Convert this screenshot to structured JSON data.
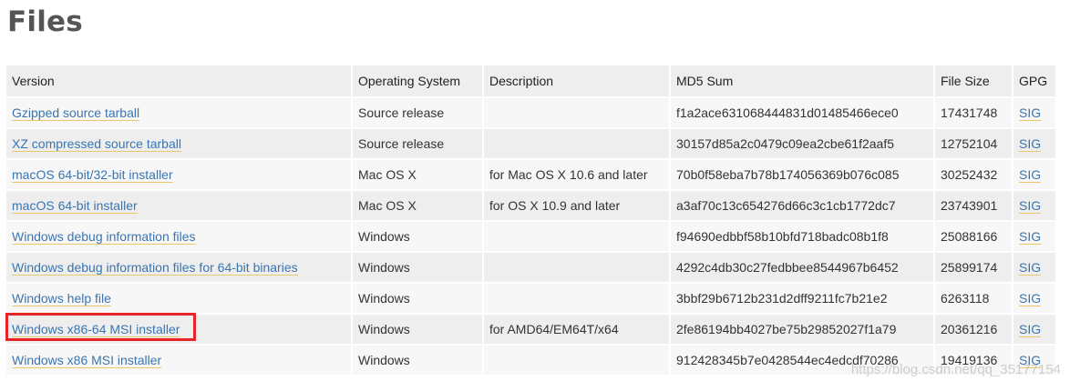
{
  "page": {
    "title": "Files"
  },
  "table": {
    "headers": {
      "version": "Version",
      "os": "Operating System",
      "description": "Description",
      "md5": "MD5 Sum",
      "size": "File Size",
      "gpg": "GPG"
    },
    "rows": [
      {
        "version": "Gzipped source tarball",
        "os": "Source release",
        "description": "",
        "md5": "f1a2ace631068444831d01485466ece0",
        "size": "17431748",
        "gpg": "SIG"
      },
      {
        "version": "XZ compressed source tarball",
        "os": "Source release",
        "description": "",
        "md5": "30157d85a2c0479c09ea2cbe61f2aaf5",
        "size": "12752104",
        "gpg": "SIG"
      },
      {
        "version": "macOS 64-bit/32-bit installer",
        "os": "Mac OS X",
        "description": "for Mac OS X 10.6 and later",
        "md5": "70b0f58eba7b78b174056369b076c085",
        "size": "30252432",
        "gpg": "SIG"
      },
      {
        "version": "macOS 64-bit installer",
        "os": "Mac OS X",
        "description": "for OS X 10.9 and later",
        "md5": "a3af70c13c654276d66c3c1cb1772dc7",
        "size": "23743901",
        "gpg": "SIG"
      },
      {
        "version": "Windows debug information files",
        "os": "Windows",
        "description": "",
        "md5": "f94690edbbf58b10bfd718badc08b1f8",
        "size": "25088166",
        "gpg": "SIG"
      },
      {
        "version": "Windows debug information files for 64-bit binaries",
        "os": "Windows",
        "description": "",
        "md5": "4292c4db30c27fedbbee8544967b6452",
        "size": "25899174",
        "gpg": "SIG"
      },
      {
        "version": "Windows help file",
        "os": "Windows",
        "description": "",
        "md5": "3bbf29b6712b231d2dff9211fc7b21e2",
        "size": "6263118",
        "gpg": "SIG"
      },
      {
        "version": "Windows x86-64 MSI installer",
        "os": "Windows",
        "description": "for AMD64/EM64T/x64",
        "md5": "2fe86194bb4027be75b29852027f1a79",
        "size": "20361216",
        "gpg": "SIG"
      },
      {
        "version": "Windows x86 MSI installer",
        "os": "Windows",
        "description": "",
        "md5": "912428345b7e0428544ec4edcdf70286",
        "size": "19419136",
        "gpg": "SIG"
      }
    ]
  },
  "highlight": {
    "color": "#e8232a"
  },
  "watermark": {
    "text": "https://blog.csdn.net/qq_35177154"
  },
  "colors": {
    "link": "#3a75b0",
    "link_underline": "#e8c86a",
    "header_bg": "#eeeeee"
  }
}
